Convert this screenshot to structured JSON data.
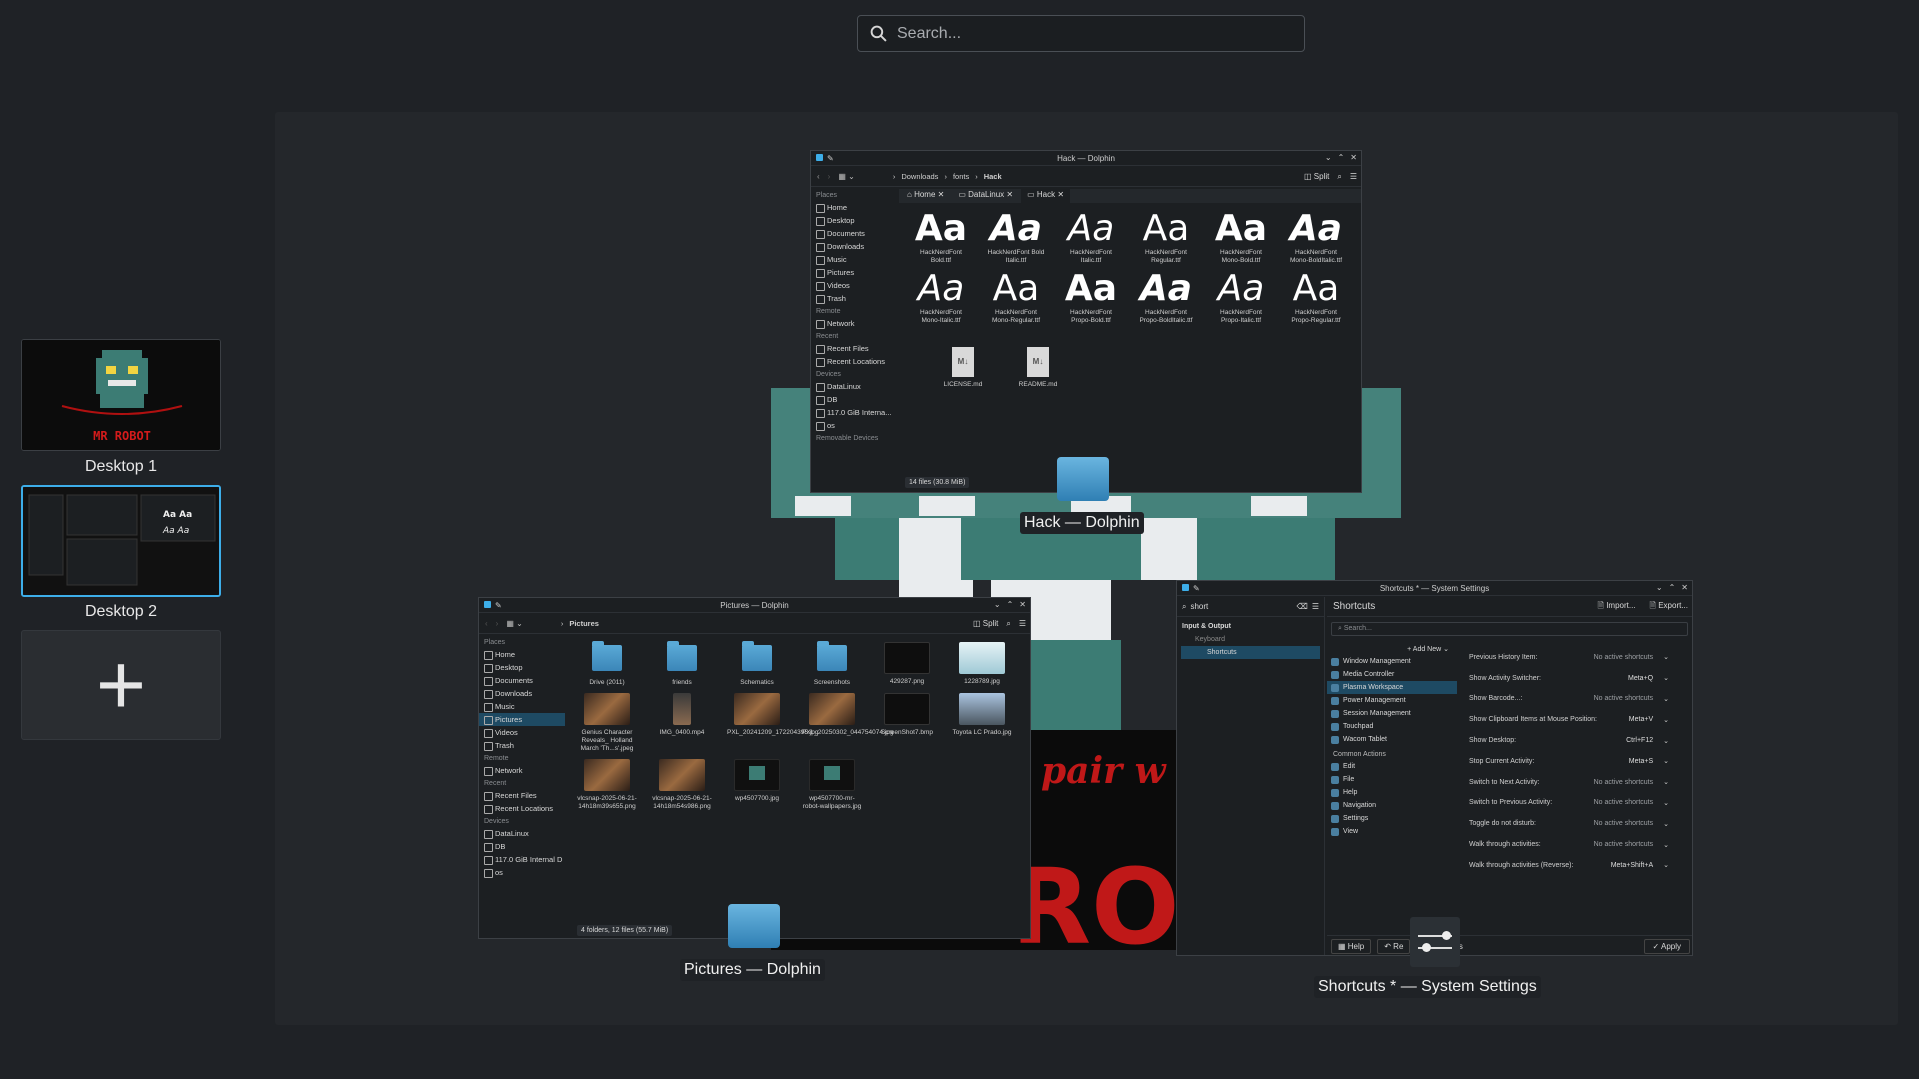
{
  "search": {
    "placeholder": "Search..."
  },
  "desktops": [
    {
      "label": "Desktop 1",
      "thumb_text": "MR ROBOT"
    },
    {
      "label": "Desktop 2"
    }
  ],
  "add_desktop": {
    "symbol": "+"
  },
  "hack_window": {
    "title": "Hack — Dolphin",
    "label": "Hack — Dolphin",
    "breadcrumb": [
      "Downloads",
      "fonts",
      "Hack"
    ],
    "split_label": "Split",
    "tabs": [
      "Home",
      "DataLinux",
      "Hack"
    ],
    "places_header": "Places",
    "places": [
      "Home",
      "Desktop",
      "Documents",
      "Downloads",
      "Music",
      "Pictures",
      "Videos",
      "Trash"
    ],
    "remote_header": "Remote",
    "remote": [
      "Network"
    ],
    "recent_header": "Recent",
    "recent": [
      "Recent Files",
      "Recent Locations"
    ],
    "devices_header": "Devices",
    "devices": [
      "DataLinux",
      "DB",
      "117.0 GiB Interna...",
      "os"
    ],
    "removable_header": "Removable Devices",
    "sample": "Aa",
    "fonts": [
      {
        "name": "HackNerdFont Bold.ttf",
        "style": "bold"
      },
      {
        "name": "HackNerdFont Bold Italic.ttf",
        "style": "bolditalic"
      },
      {
        "name": "HackNerdFont Italic.ttf",
        "style": "italic"
      },
      {
        "name": "HackNerdFont Regular.ttf",
        "style": "regular"
      },
      {
        "name": "HackNerdFont Mono-Bold.ttf",
        "style": "bold"
      },
      {
        "name": "HackNerdFont Mono-BoldItalic.ttf",
        "style": "bolditalic"
      },
      {
        "name": "HackNerdFont Mono-Italic.ttf",
        "style": "italic"
      },
      {
        "name": "HackNerdFont Mono-Regular.ttf",
        "style": "regular"
      },
      {
        "name": "HackNerdFont Propo-Bold.ttf",
        "style": "bold"
      },
      {
        "name": "HackNerdFont Propo-BoldItalic.ttf",
        "style": "bolditalic"
      },
      {
        "name": "HackNerdFont Propo-Italic.ttf",
        "style": "italic"
      },
      {
        "name": "HackNerdFont Propo-Regular.ttf",
        "style": "regular"
      }
    ],
    "docs": [
      "LICENSE.md",
      "README.md"
    ],
    "doc_badge": "M↓",
    "status": "14 files (30.8 MiB)"
  },
  "pictures_window": {
    "title": "Pictures — Dolphin",
    "label": "Pictures — Dolphin",
    "breadcrumb": [
      "Pictures"
    ],
    "split_label": "Split",
    "places_header": "Places",
    "places": [
      "Home",
      "Desktop",
      "Documents",
      "Downloads",
      "Music",
      "Pictures",
      "Videos",
      "Trash"
    ],
    "remote_header": "Remote",
    "remote": [
      "Network"
    ],
    "recent_header": "Recent",
    "recent": [
      "Recent Files",
      "Recent Locations"
    ],
    "devices_header": "Devices",
    "devices": [
      "DataLinux",
      "DB",
      "117.0 GiB Internal D",
      "os"
    ],
    "items": [
      {
        "name": "Drive (2011)",
        "kind": "folder"
      },
      {
        "name": "friends",
        "kind": "folder"
      },
      {
        "name": "Schematics",
        "kind": "folder"
      },
      {
        "name": "Screenshots",
        "kind": "folder"
      },
      {
        "name": "429287.png",
        "kind": "dark"
      },
      {
        "name": "1228789.jpg",
        "kind": "light"
      },
      {
        "name": "Genius Character Reveals_ Holland March 'Th...s'.jpeg",
        "kind": "brown"
      },
      {
        "name": "IMG_0400.mp4",
        "kind": "video"
      },
      {
        "name": "PXL_20241209_172204395.jpg",
        "kind": "brown"
      },
      {
        "name": "PXL_20250302_044754074.jpg",
        "kind": "brown"
      },
      {
        "name": "ScreenShot7.bmp",
        "kind": "dark"
      },
      {
        "name": "Toyota LC Prado.jpg",
        "kind": "car"
      },
      {
        "name": "vlcsnap-2025-06-21-14h18m39s655.png",
        "kind": "brown"
      },
      {
        "name": "vlcsnap-2025-06-21-14h18m54s986.png",
        "kind": "brown"
      },
      {
        "name": "wp4507700.jpg",
        "kind": "robot"
      },
      {
        "name": "wp4507700-mr-robot-wallpapers.jpg",
        "kind": "robot"
      }
    ],
    "status": "4 folders, 12 files (55.7 MiB)"
  },
  "settings_window": {
    "title": "Shortcuts * — System Settings",
    "label": "Shortcuts * — System Settings",
    "search_value": "short",
    "page_title": "Shortcuts",
    "import_label": "Import...",
    "export_label": "Export...",
    "section_header": "Input & Output",
    "keyboard_item": "Keyboard",
    "shortcuts_item": "Shortcuts",
    "filter_placeholder": "Search...",
    "add_new_label": "Add New",
    "categories": [
      "Window Management",
      "Media Controller",
      "Plasma Workspace",
      "Power Management",
      "Session Management",
      "Touchpad",
      "Wacom Tablet"
    ],
    "common_header": "Common Actions",
    "common": [
      "Edit",
      "File",
      "Help",
      "Navigation",
      "Settings",
      "View"
    ],
    "shortcuts": [
      {
        "action": "Previous History Item:",
        "keys": "No active shortcuts"
      },
      {
        "action": "Show Activity Switcher:",
        "keys": "Meta+Q"
      },
      {
        "action": "Show Barcode...:",
        "keys": "No active shortcuts"
      },
      {
        "action": "Show Clipboard Items at Mouse Position:",
        "keys": "Meta+V"
      },
      {
        "action": "Show Desktop:",
        "keys": "Ctrl+F12"
      },
      {
        "action": "Stop Current Activity:",
        "keys": "Meta+S"
      },
      {
        "action": "Switch to Next Activity:",
        "keys": "No active shortcuts"
      },
      {
        "action": "Switch to Previous Activity:",
        "keys": "No active shortcuts"
      },
      {
        "action": "Toggle do not disturb:",
        "keys": "No active shortcuts"
      },
      {
        "action": "Walk through activities:",
        "keys": "No active shortcuts"
      },
      {
        "action": "Walk through activities (Reverse):",
        "keys": "Meta+Shift+A"
      }
    ],
    "help_label": "Help",
    "reset_label": "Re",
    "defaults_label": "ults",
    "apply_label": "Apply"
  },
  "wallpaper_text": {
    "script": "pair w",
    "big": "ROI"
  },
  "colors": {
    "accent": "#3daee9",
    "teal": "#3c7c74",
    "wallpaper_red": "#c01818"
  }
}
